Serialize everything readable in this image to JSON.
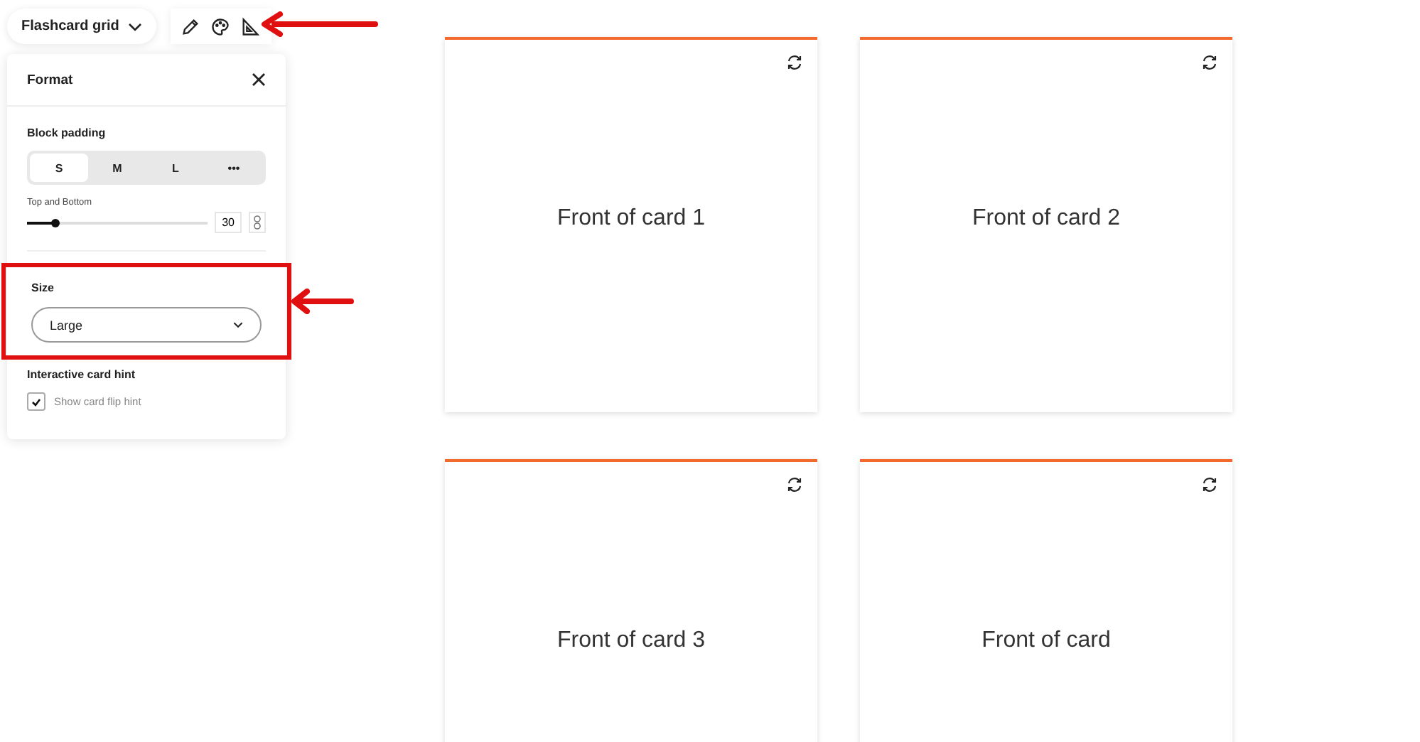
{
  "block_menu": {
    "label": "Flashcard grid"
  },
  "toolbar": [
    {
      "kind": "pencil"
    },
    {
      "kind": "palette"
    },
    {
      "kind": "ruler"
    }
  ],
  "panel": {
    "title": "Format",
    "block_padding": {
      "label": "Block padding",
      "options": [
        {
          "label": "S",
          "selected": true
        },
        {
          "label": "M",
          "selected": false
        },
        {
          "label": "L",
          "selected": false
        },
        {
          "label": "•••",
          "selected": false
        }
      ]
    },
    "slider": {
      "label": "Top and Bottom",
      "level": 0.16,
      "value": "30"
    },
    "size": {
      "label": "Size",
      "value": "Large",
      "highlighted": true
    },
    "hint": {
      "label": "Interactive card hint",
      "checkbox": "Show card flip hint",
      "checked": true
    }
  },
  "cards": [
    {
      "text": "Front of card 1"
    },
    {
      "text": "Front of card 2"
    },
    {
      "text": "Front of card 3"
    },
    {
      "text": "Front of card"
    }
  ]
}
